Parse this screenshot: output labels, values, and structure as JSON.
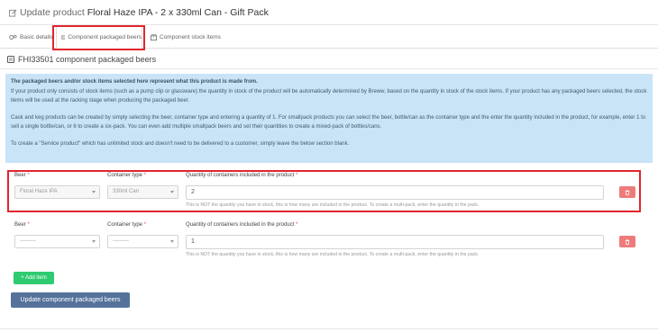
{
  "header": {
    "title_prefix": "Update product",
    "title_product": "Floral Haze IPA - 2 x 330ml Can - Gift Pack"
  },
  "tabs": [
    {
      "label": "Basic details"
    },
    {
      "label": "Component packaged beers",
      "active": true
    },
    {
      "label": "Component stock items"
    }
  ],
  "section": {
    "title": "FHI33501 component packaged beers"
  },
  "info": {
    "heading": "The packaged beers and/or stock items selected here represent what this product is made from.",
    "para1": "If your product only consists of stock items (such as a pump clip or glassware) the quantity in stock of the product will be automatically determined by Breww, based on the quantity in stock of the stock items. If your product has any packaged beers selected, the stock items will be used at the racking stage when producing the packaged beer.",
    "para2": "Cask and keg products can be created by simply selecting the beer, container type and entering a quantity of 1. For smallpack products you can select the beer, bottle/can as the container type and the enter the quantity included in the product, for example, enter 1 to sell a single bottle/can, or 6 to create a six-pack. You can even add multiple smallpack beers and set their quantities to create a mixed-pack of bottles/cans.",
    "para3": "To create a \"Service product\" which has unlimited stock and doesn't need to be delivered to a customer, simply leave the below section blank."
  },
  "labels": {
    "beer": "Beer",
    "container_type": "Container type",
    "quantity": "Quantity of containers included in the product",
    "required_mark": "*",
    "hint": "This is NOT the quantity you have in stock, this is how many are included in the product. To create a multi-pack, enter the quantity in the pack."
  },
  "rows": [
    {
      "beer": "Floral Haze IPA",
      "container_type": "330ml Can",
      "quantity": "2"
    },
    {
      "beer": "---------",
      "container_type": "---------",
      "quantity": "1"
    }
  ],
  "buttons": {
    "add_item": "+ Add item",
    "update": "Update component packaged beers"
  },
  "colors": {
    "highlight": "#e1262d",
    "info_bg": "#c9e3f7",
    "add_btn": "#2fcb71",
    "update_btn": "#55729b",
    "delete_btn": "#ee7b7b"
  },
  "icons": {
    "header": "pencil-icon",
    "tab_basic": "gears-icon",
    "tab_component": "beer-list-icon",
    "tab_stock": "box-icon",
    "delete": "trash-icon"
  }
}
